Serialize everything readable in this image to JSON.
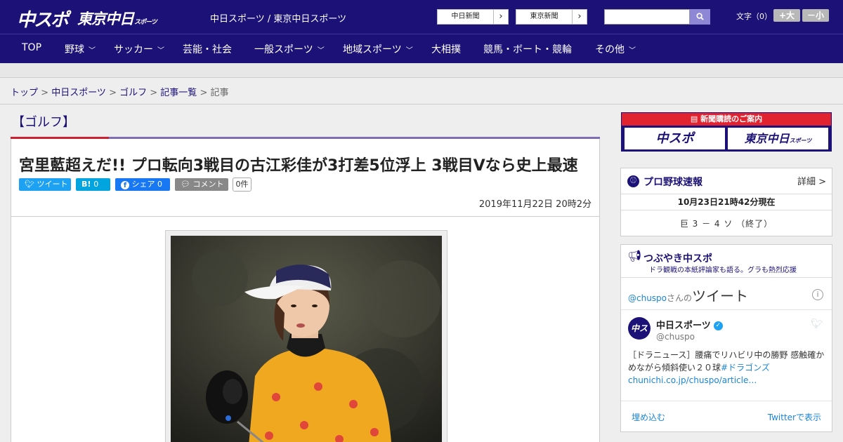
{
  "header": {
    "logo_main": "中スポ",
    "logo_tokyo": "東京中日",
    "logo_tokyo_suffix": "スポーツ",
    "sites_text": "中日スポーツ / 東京中日スポーツ",
    "site_buttons": [
      {
        "label": "中日新聞",
        "arrow": "›"
      },
      {
        "label": "東京新聞",
        "arrow": "›"
      }
    ],
    "search_placeholder": "",
    "search_icon": "magnifier-icon",
    "font_size_label": "文字（0）",
    "font_plus": "+大",
    "font_minus": "－小"
  },
  "nav": [
    {
      "label": "TOP",
      "chevron": ""
    },
    {
      "label": "野球",
      "chevron": "﹀"
    },
    {
      "label": "サッカー",
      "chevron": "﹀"
    },
    {
      "label": "芸能・社会",
      "chevron": ""
    },
    {
      "label": "一般スポーツ",
      "chevron": "﹀"
    },
    {
      "label": "地域スポーツ",
      "chevron": "﹀"
    },
    {
      "label": "大相撲",
      "chevron": ""
    },
    {
      "label": "競馬・ボート・競輪",
      "chevron": ""
    },
    {
      "label": "その他",
      "chevron": "﹀"
    }
  ],
  "breadcrumb": {
    "items": [
      "トップ",
      "中日スポーツ",
      "ゴルフ",
      "記事一覧"
    ],
    "separator": " > ",
    "current": "記事"
  },
  "article": {
    "category": "【ゴルフ】",
    "headline": "宮里藍超えだ!! プロ転向3戦目の古江彩佳が3打差5位浮上 3戦目Vなら史上最速",
    "share": {
      "tweet": "ツイート",
      "hatena": "B!",
      "hatena_count": "0",
      "facebook": "シェア",
      "facebook_count": "0",
      "comment": "コメント",
      "comment_count": "0件"
    },
    "date": "2019年11月22日 20時2分"
  },
  "sidebar": {
    "ad": {
      "title": "新聞購読のご案内",
      "logo_left": "中スポ",
      "logo_right": "東京中日",
      "logo_right_suffix": "スポーツ"
    },
    "baseball": {
      "title": "プロ野球速報",
      "detail": "詳細 >",
      "time": "10月23日21時42分現在",
      "score": "巨 3 － 4 ソ （終了）"
    },
    "tsubuyaki": {
      "title": "つぶやき中スポ",
      "subtitle": "ドラ観戦の本紙評論家も語る。グラも熱烈応援",
      "tw_head_prefix": "@chuspo",
      "tw_head_mid": "さんの",
      "tw_head_big": "ツイート",
      "info": "i",
      "avatar_text": "中スポ",
      "name": "中日スポーツ",
      "verified": "✓",
      "handle": "@chuspo",
      "text_main": "［ドラニュース］腰痛でリハビリ中の勝野 感触確かめながら傾斜使い２０球",
      "hashtag": "#ドラゴンズ",
      "link": "chunichi.co.jp/chuspo/article…",
      "embed": "埋め込む",
      "view": "Twitterで表示"
    }
  }
}
